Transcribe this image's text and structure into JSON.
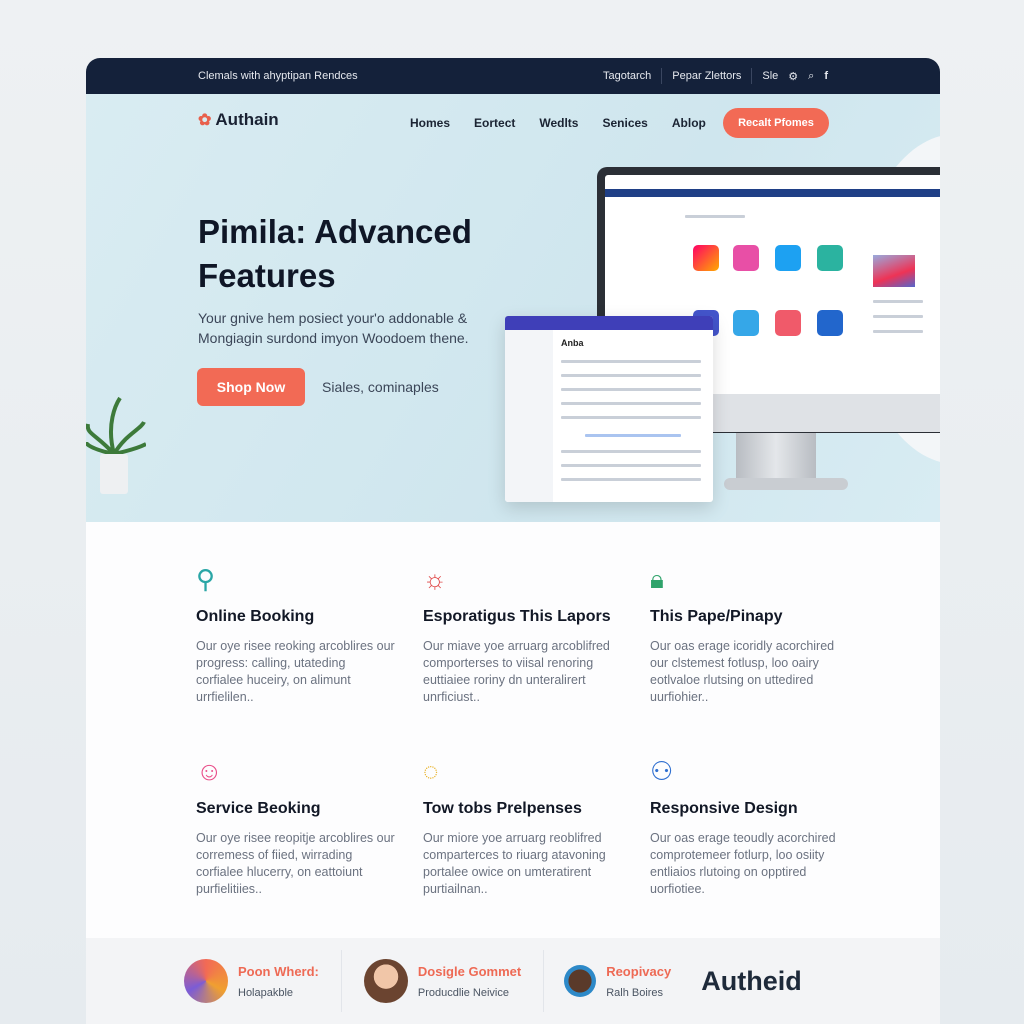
{
  "topbar": {
    "tagline": "Clemals with ahyptipan Rendces",
    "links": [
      "Tagotarch",
      "Pepar Zlettors",
      "Sle"
    ],
    "icons": [
      "settings-icon",
      "search-icon",
      "facebook-icon"
    ]
  },
  "header": {
    "logo": "Authain",
    "nav": [
      "Homes",
      "Eortect",
      "Wedlts",
      "Senices",
      "Ablop"
    ],
    "cta": "Recalt Pfomes"
  },
  "hero": {
    "title": "Pimila: Advanced Features",
    "subtitle": "Your gnive hem posiect your'o addonable & Mongiagin surdond imyon Woodoem thene.",
    "primary_button": "Shop Now",
    "secondary_text": "Siales, cominaples",
    "mock_label": "Anba"
  },
  "features": [
    {
      "icon": "user-icon",
      "color": "#2aa6a6",
      "title": "Online Booking",
      "text": "Our oye risee reoking arcoblires our progress: calling, utateding corfialee huceiry, on alimunt urrfielilen.."
    },
    {
      "icon": "sun-icon",
      "color": "#e04a4a",
      "title": "Esporatigus This Lapors",
      "text": "Our miave yoe arruarg arcoblifred comporterses to viisal renoring euttiaiee roriny dn unteralirert unrficiust.."
    },
    {
      "icon": "lock-icon",
      "color": "#2fa36b",
      "title": "This Pape/Pinapy",
      "text": "Our oas erage icoridly acorchired our clstemest fotlusp, loo oairy eotlvaloe rlutsing on uttedired uurfiohier.."
    },
    {
      "icon": "support-icon",
      "color": "#e94f8a",
      "title": "Service Beoking",
      "text": "Our oye risee reopitje arcoblires our corremess of fiied, wirrading corfialee hlucerry, on eattoiunt purfielitiies.."
    },
    {
      "icon": "lightbulb-icon",
      "color": "#e9b530",
      "title": "Tow tobs Prelpenses",
      "text": "Our miore yoe arruarg reoblifred comparterces to riuarg atavoning portalee owice on umteratirent purtiailnan.."
    },
    {
      "icon": "users-icon",
      "color": "#2f6fd0",
      "title": "Responsive Design",
      "text": "Our oas erage teoudly acorchired comprotemeer fotlurp, loo osiity entliaios rlutoing on opptired uorfiotiee."
    }
  ],
  "bottom": {
    "items": [
      {
        "title": "Poon Wherd:",
        "sub": "Holapakble"
      },
      {
        "title": "Dosigle Gommet",
        "sub": "Producdlie Neivice"
      },
      {
        "title": "Reopivacy",
        "sub": "Ralh Boires"
      }
    ],
    "brand": "Autheid"
  },
  "colors": {
    "accent": "#f26a55",
    "dark": "#14213a"
  }
}
